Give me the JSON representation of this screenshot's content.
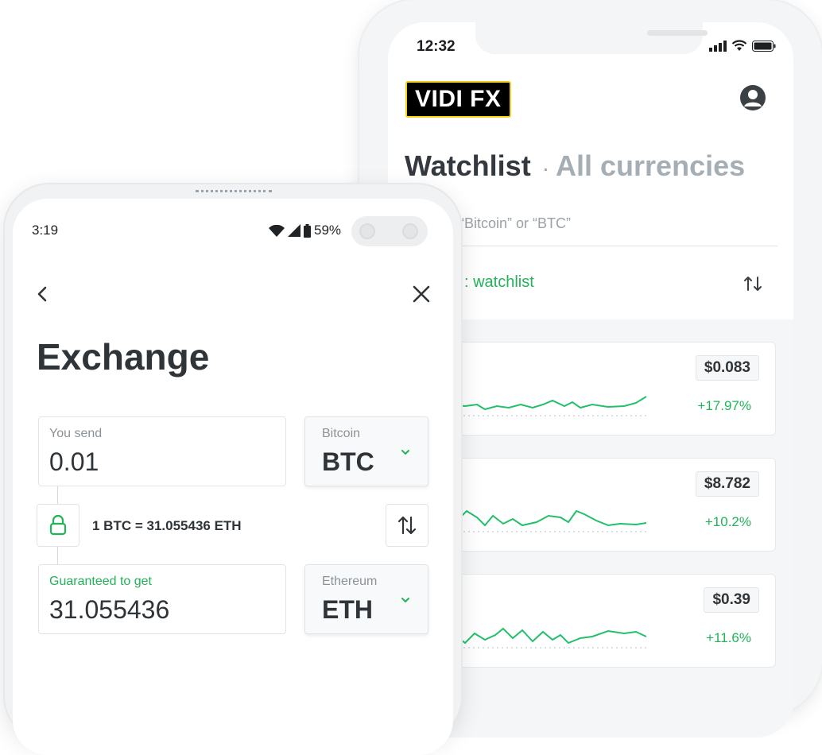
{
  "ios": {
    "time": "12:32",
    "logo_text": "VIDI FX",
    "title": "Watchlist",
    "subtitle": "All currencies",
    "search_placeholder": "“Bitcoin” or “BTC”",
    "edit_label": ": watchlist",
    "cards": [
      {
        "price": "$0.083",
        "change": "+17.97%"
      },
      {
        "price": "$8.782",
        "change": "+10.2%"
      },
      {
        "price": "$0.39",
        "change": "+11.6%"
      }
    ]
  },
  "android": {
    "time": "3:19",
    "battery": "59%",
    "title": "Exchange",
    "send": {
      "label": "You send",
      "value": "0.01"
    },
    "send_currency": {
      "name": "Bitcoin",
      "code": "BTC"
    },
    "rate": "1 BTC = 31.055436 ETH",
    "receive": {
      "label": "Guaranteed to get",
      "value": "31.055436"
    },
    "receive_currency": {
      "name": "Ethereum",
      "code": "ETH"
    }
  },
  "colors": {
    "accent_green": "#22b35a",
    "logo_border": "#f2d21a"
  }
}
